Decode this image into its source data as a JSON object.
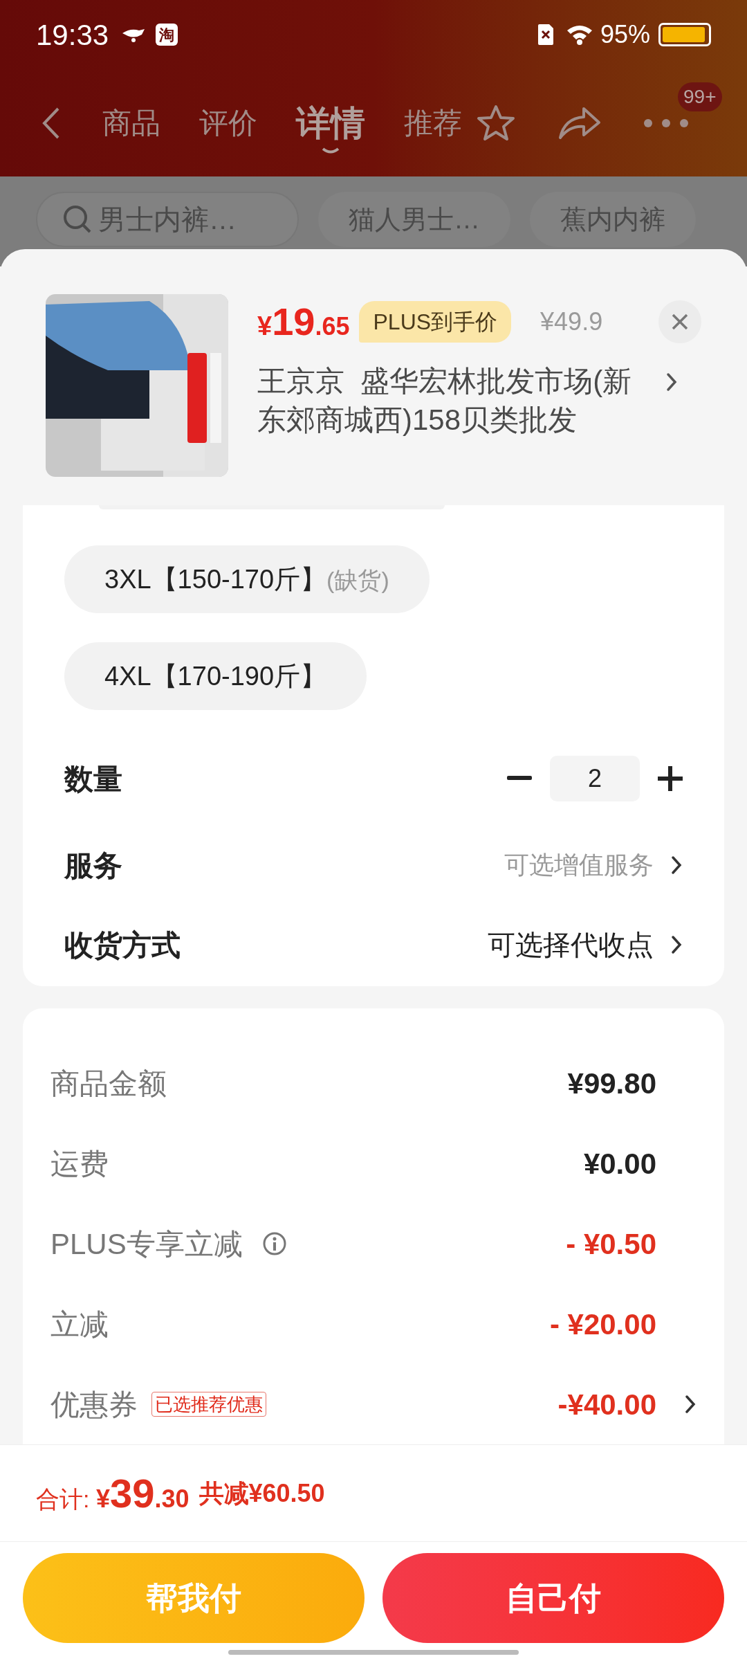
{
  "status_bar": {
    "time": "19:33",
    "app_icon_text": "淘",
    "battery": "95%"
  },
  "nav": {
    "tabs": [
      {
        "label": "商品",
        "selected": false
      },
      {
        "label": "评价",
        "selected": false
      },
      {
        "label": "详情",
        "selected": true
      },
      {
        "label": "推荐",
        "selected": false
      }
    ],
    "badge": "99+"
  },
  "search_chips": [
    {
      "text": "男士内裤…",
      "kind": "search"
    },
    {
      "text": "猫人男士…",
      "kind": "chip"
    },
    {
      "text": "蕉内内裤",
      "kind": "chip"
    }
  ],
  "product": {
    "currency": "¥",
    "price_int": "19",
    "price_dec": ".65",
    "plus_tag": "PLUS到手价",
    "original_price": "¥49.9",
    "shop": "王京京  盛华宏林批发市场(新东郊商城西)158贝类批发"
  },
  "sizes": [
    {
      "label": "3XL【150-170斤】",
      "note": "(缺货)"
    },
    {
      "label": "4XL【170-190斤】"
    }
  ],
  "quantity": {
    "label": "数量",
    "value": "2"
  },
  "options": [
    {
      "label": "服务",
      "value": "可选增值服务",
      "muted": true
    },
    {
      "label": "收货方式",
      "value": "可选择代收点",
      "muted": false
    }
  ],
  "fees": [
    {
      "label": "商品金额",
      "amount": "¥99.80",
      "kind": "plain"
    },
    {
      "label": "运费",
      "amount": "¥0.00",
      "kind": "plain"
    },
    {
      "label": "PLUS专享立减",
      "amount": "- ¥0.50",
      "kind": "discount",
      "info": true
    },
    {
      "label": "立减",
      "amount": "- ¥20.00",
      "kind": "discount"
    },
    {
      "label": "优惠券",
      "amount": "-¥40.00",
      "kind": "discount",
      "tag": "已选推荐优惠",
      "chevron": true
    }
  ],
  "total": {
    "label": "合计:",
    "currency": "¥",
    "int": "39",
    "dec": ".30",
    "saved": "共减¥60.50"
  },
  "buttons": [
    {
      "label": "帮我付",
      "kind": "secondary"
    },
    {
      "label": "自己付",
      "kind": "primary"
    }
  ]
}
